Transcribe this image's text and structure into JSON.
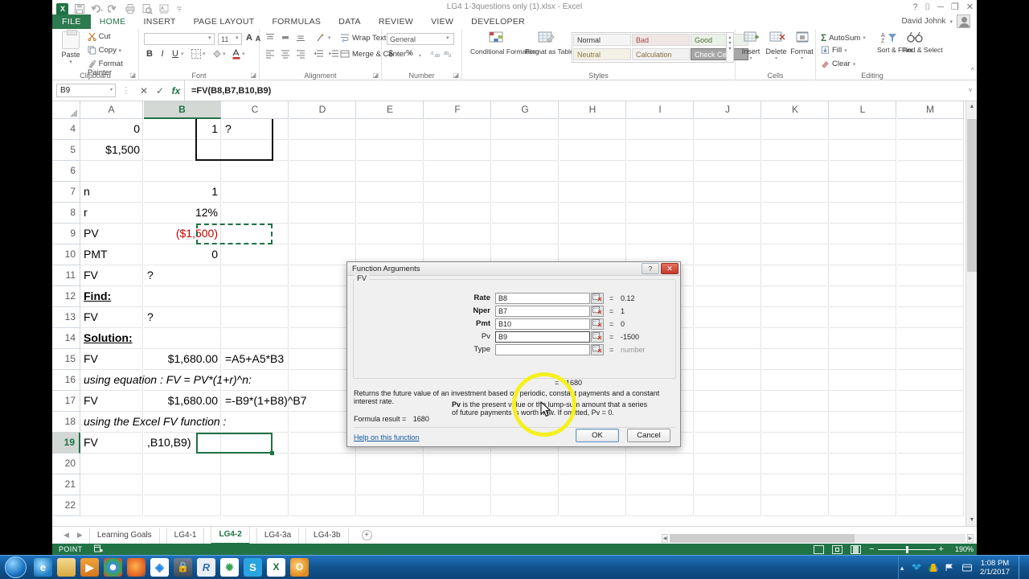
{
  "window": {
    "title": "LG4 1-3questions only (1).xlsx - Excel",
    "account_name": "David Johnk",
    "qat": [
      "save-icon",
      "undo-icon",
      "redo-icon",
      "quick-print-icon",
      "print-preview-icon",
      "spelling-icon",
      "customize-icon"
    ],
    "controls": {
      "help": "?",
      "ribbon_options": "⌷",
      "minimize": "─",
      "restore": "❐",
      "close": "✕"
    }
  },
  "ribbon": {
    "file_tab": "FILE",
    "tabs": [
      "HOME",
      "INSERT",
      "PAGE LAYOUT",
      "FORMULAS",
      "DATA",
      "REVIEW",
      "VIEW",
      "DEVELOPER"
    ],
    "active_tab": "HOME",
    "groups": {
      "clipboard": {
        "label": "Clipboard",
        "paste": "Paste",
        "cut": "Cut",
        "copy": "Copy",
        "format_painter": "Format Painter"
      },
      "font": {
        "label": "Font",
        "font_name": "",
        "font_size": "11",
        "grow_font": "A",
        "shrink_font": "A",
        "bold": "B",
        "italic": "I",
        "underline": "U"
      },
      "alignment": {
        "label": "Alignment",
        "wrap_text": "Wrap Text",
        "merge_center": "Merge & Center"
      },
      "number": {
        "label": "Number",
        "format": "General",
        "accounting": "$",
        "percent": "%",
        "comma": ","
      },
      "styles": {
        "label": "Styles",
        "conditional_formatting": "Conditional Formatting",
        "format_as_table": "Format as Table",
        "cell_styles": [
          "Normal",
          "Bad",
          "Good",
          "Neutral",
          "Calculation",
          "Check Cell"
        ]
      },
      "cells": {
        "label": "Cells",
        "insert": "Insert",
        "delete": "Delete",
        "format": "Format"
      },
      "editing": {
        "label": "Editing",
        "autosum": "AutoSum",
        "fill": "Fill",
        "clear": "Clear",
        "sort_filter": "Sort & Filter",
        "find_select": "Find & Select"
      }
    }
  },
  "formula_bar": {
    "name_box": "B9",
    "cancel": "✕",
    "enter": "✓",
    "insert_function": "fx",
    "formula": "=FV(B8,B7,B10,B9)"
  },
  "grid": {
    "columns": [
      "A",
      "B",
      "C",
      "D",
      "E",
      "F",
      "G",
      "H",
      "I",
      "J",
      "K",
      "L",
      "M"
    ],
    "selected_column": "B",
    "rows": [
      "4",
      "5",
      "6",
      "7",
      "8",
      "9",
      "10",
      "11",
      "12",
      "13",
      "14",
      "15",
      "16",
      "17",
      "18",
      "19",
      "20",
      "21",
      "22"
    ],
    "active_row": "19",
    "cells": [
      {
        "row": "4",
        "col": "A",
        "text": "0",
        "align": "right"
      },
      {
        "row": "4",
        "col": "B",
        "text": "1",
        "align": "right"
      },
      {
        "row": "4",
        "col": "C",
        "text": "?",
        "align": "left"
      },
      {
        "row": "5",
        "col": "A",
        "text": "$1,500",
        "align": "right"
      },
      {
        "row": "7",
        "col": "A",
        "text": "n",
        "align": "left"
      },
      {
        "row": "7",
        "col": "B",
        "text": "1",
        "align": "right"
      },
      {
        "row": "8",
        "col": "A",
        "text": "r",
        "align": "left"
      },
      {
        "row": "8",
        "col": "B",
        "text": "12%",
        "align": "right"
      },
      {
        "row": "9",
        "col": "A",
        "text": "PV",
        "align": "left"
      },
      {
        "row": "9",
        "col": "B",
        "text": "($1,500)",
        "align": "right",
        "style": "red"
      },
      {
        "row": "10",
        "col": "A",
        "text": "PMT",
        "align": "left"
      },
      {
        "row": "10",
        "col": "B",
        "text": "0",
        "align": "right"
      },
      {
        "row": "11",
        "col": "A",
        "text": "FV",
        "align": "left"
      },
      {
        "row": "11",
        "col": "B",
        "text": "?",
        "align": "left"
      },
      {
        "row": "12",
        "col": "A",
        "text": "Find:",
        "align": "left",
        "style": "bold-u"
      },
      {
        "row": "13",
        "col": "A",
        "text": "FV",
        "align": "left"
      },
      {
        "row": "13",
        "col": "B",
        "text": "?",
        "align": "left"
      },
      {
        "row": "14",
        "col": "A",
        "text": "Solution:",
        "align": "left",
        "style": "bold-u"
      },
      {
        "row": "15",
        "col": "A",
        "text": "FV",
        "align": "left"
      },
      {
        "row": "15",
        "col": "B",
        "text": "$1,680.00",
        "align": "right"
      },
      {
        "row": "15",
        "col": "C",
        "text": "=A5+A5*B3",
        "align": "left"
      },
      {
        "row": "16",
        "col": "A",
        "text": "using equation : FV = PV*(1+r)^n:",
        "align": "left",
        "style": "ital"
      },
      {
        "row": "17",
        "col": "A",
        "text": "FV",
        "align": "left"
      },
      {
        "row": "17",
        "col": "B",
        "text": "$1,680.00",
        "align": "right"
      },
      {
        "row": "17",
        "col": "C",
        "text": "=-B9*(1+B8)^B7",
        "align": "left"
      },
      {
        "row": "18",
        "col": "A",
        "text": "using the Excel FV function :",
        "align": "left",
        "style": "ital"
      },
      {
        "row": "19",
        "col": "A",
        "text": "FV",
        "align": "left"
      },
      {
        "row": "19",
        "col": "B",
        "text": ",B10,B9)",
        "align": "left"
      }
    ]
  },
  "sheet_tabs": {
    "tabs": [
      "Learning Goals",
      "LG4-1",
      "LG4-2",
      "LG4-3a",
      "LG4-3b"
    ],
    "active": "LG4-2",
    "add_label": "+"
  },
  "status_bar": {
    "mode": "POINT",
    "zoom": "190%",
    "views": [
      "normal-view-icon",
      "page-layout-view-icon",
      "page-break-view-icon"
    ]
  },
  "dialog": {
    "title": "Function Arguments",
    "function_name": "FV",
    "help_btn": "?",
    "close_btn": "✕",
    "arguments": [
      {
        "label": "Rate",
        "value": "B8",
        "result": "0.12",
        "bold": true
      },
      {
        "label": "Nper",
        "value": "B7",
        "result": "1",
        "bold": true
      },
      {
        "label": "Pmt",
        "value": "B10",
        "result": "0",
        "bold": true
      },
      {
        "label": "Pv",
        "value": "B9",
        "result": "-1500",
        "bold": false
      },
      {
        "label": "Type",
        "value": "",
        "result": "number",
        "bold": false
      }
    ],
    "eq_sign": "=",
    "preview_result": "1680",
    "description": "Returns the future value of an investment based on periodic, constant payments and a constant interest rate.",
    "arg_help_name": "Pv",
    "arg_help_text": "is the present value or the lump-sum amount that a series of future payments is worth now. If omitted, Pv = 0.",
    "formula_result_label": "Formula result =",
    "formula_result_value": "1680",
    "help_link": "Help on this function",
    "ok": "OK",
    "cancel": "Cancel"
  },
  "taskbar": {
    "start": "start-orb",
    "apps": [
      "internet-explorer-icon",
      "explorer-icon",
      "media-player-icon",
      "chrome-icon",
      "firefox-icon",
      "dropbox-icon",
      "lastpass-icon",
      "r-icon",
      "yahoo-icon",
      "skype-icon",
      "excel-icon",
      "office-icon"
    ],
    "tray": [
      "show-hidden-icon",
      "dropbox-tray-icon",
      "drive-tray-icon",
      "network-icon",
      "action-center-icon"
    ],
    "clock_time": "1:08 PM",
    "clock_date": "2/1/2017"
  },
  "colors": {
    "excel_green": "#217346",
    "selection_green": "#1f7244",
    "negative_red": "#c00000",
    "highlight_yellow": "#f5f01e",
    "taskbar_blue": "#12538e"
  }
}
